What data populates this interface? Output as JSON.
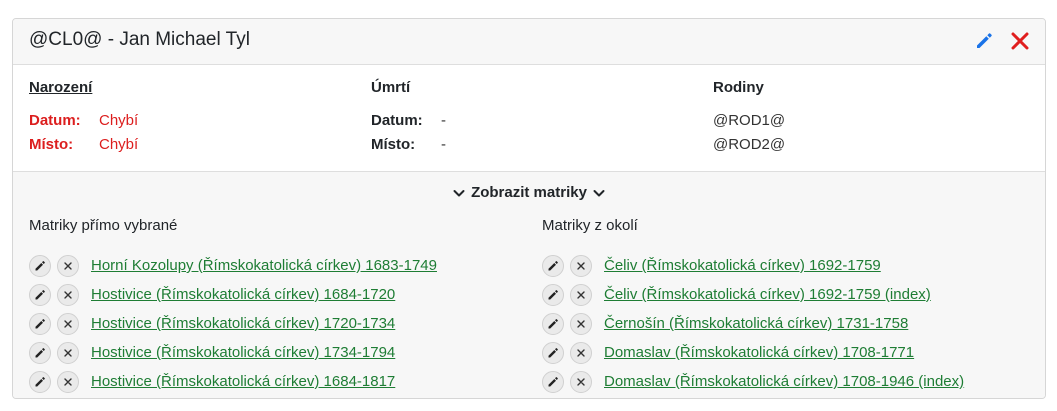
{
  "header": {
    "title": "@CL0@ - Jan Michael Tyl",
    "edit_icon": "pencil-icon",
    "close_icon": "close-icon",
    "edit_color": "#1a73e8",
    "close_color": "#e01e1e"
  },
  "birth": {
    "heading": "Narození",
    "date_label": "Datum:",
    "date_value": "Chybí",
    "place_label": "Místo:",
    "place_value": "Chybí"
  },
  "death": {
    "heading": "Úmrtí",
    "date_label": "Datum:",
    "date_value": "-",
    "place_label": "Místo:",
    "place_value": "-"
  },
  "families": {
    "heading": "Rodiny",
    "items": [
      "@ROD1@",
      "@ROD2@"
    ]
  },
  "matriky": {
    "toggle_label": "Zobrazit matriky",
    "direct_title": "Matriky přímo vybrané",
    "nearby_title": "Matriky z okolí",
    "direct": [
      "Horní Kozolupy (Římskokatolická církev) 1683-1749",
      "Hostivice (Římskokatolická církev) 1684-1720",
      "Hostivice (Římskokatolická církev) 1720-1734",
      "Hostivice (Římskokatolická církev) 1734-1794",
      "Hostivice (Římskokatolická církev) 1684-1817"
    ],
    "nearby": [
      "Čeliv (Římskokatolická církev) 1692-1759",
      "Čeliv (Římskokatolická církev) 1692-1759 (index)",
      "Černošín (Římskokatolická církev) 1731-1758",
      "Domaslav (Římskokatolická církev) 1708-1771",
      "Domaslav (Římskokatolická církev) 1708-1946 (index)"
    ],
    "link_color": "#1e7d34"
  }
}
